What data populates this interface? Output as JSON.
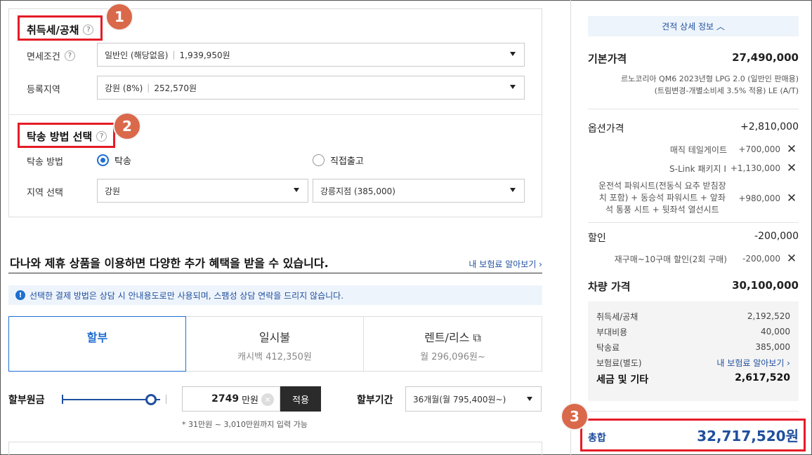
{
  "tax_section": {
    "title": "취득세/공채",
    "duty_free_label": "면세조건",
    "duty_free_value": "일반인 (해당없음)",
    "duty_free_amount": "1,939,950원",
    "region_label": "등록지역",
    "region_value": "강원 (8%)",
    "region_amount": "252,570원"
  },
  "delivery_section": {
    "title": "탁송 방법 선택",
    "method_label": "탁송 방법",
    "option_delivery": "탁송",
    "option_pickup": "직접출고",
    "area_label": "지역 선택",
    "area_value": "강원",
    "branch_value": "강릉지점 (385,000)"
  },
  "badges": [
    "1",
    "2",
    "3"
  ],
  "question_mark": "?",
  "promo": {
    "title": "다나와 제휴 상품을 이용하면 다양한 추가 혜택을 받을 수 있습니다.",
    "link": "내 보험료 알아보기 ›",
    "notice_icon": "!",
    "notice": "선택한 결제 방법은 상담 시 안내용도로만 사용되며, 스팸성 상담 연락을 드리지 않습니다."
  },
  "payment_tabs": [
    {
      "label": "할부",
      "sub": ""
    },
    {
      "label": "일시불",
      "sub": "캐시백 412,350원"
    },
    {
      "label": "렌트/리스 ⧉",
      "sub": "월 296,096원~"
    }
  ],
  "installment": {
    "principal_label": "할부원금",
    "amount": "2749",
    "unit": "만원",
    "clear": "✕",
    "apply": "적용",
    "period_label": "할부기간",
    "period_value": "36개월(월 795,400원~)",
    "hint": "* 31만원 ~ 3,010만원까지 입력 가능",
    "slider_fraction": 0.91
  },
  "summary": {
    "detail_toggle": "견적 상세 정보 ︿",
    "base_label": "기본가격",
    "base_value": "27,490,000",
    "model_line1": "르노코리아 QM6 2023년형 LPG 2.0 (일반인 판매용)",
    "model_line2": "(트림변경-개별소비세 3.5% 적용) LE (A/T)",
    "option_label": "옵션가격",
    "option_value": "+2,810,000",
    "options": [
      {
        "name": "매직 테일게이트",
        "price": "+700,000"
      },
      {
        "name": "S-Link 패키지 I",
        "price": "+1,130,000"
      },
      {
        "name": "운전석 파워시트(전동식 요추 받침장\n치 포함) + 동승석 파워시트 + 앞좌\n석 통풍 시트 + 뒷좌석 열선시트",
        "price": "+980,000"
      }
    ],
    "discount_label": "할인",
    "discount_value": "-200,000",
    "discount_item": "재구매~10구매 할인(2회 구매)",
    "discount_item_price": "-200,000",
    "remove_icon": "✕",
    "car_price_label": "차량 가격",
    "car_price_value": "30,100,000",
    "taxes": [
      {
        "label": "취득세/공채",
        "value": "2,192,520"
      },
      {
        "label": "부대비용",
        "value": "40,000"
      },
      {
        "label": "탁송료",
        "value": "385,000"
      },
      {
        "label": "보험료(별도)",
        "value": "내 보험료 알아보기 ›"
      }
    ],
    "tax_total_label": "세금 및 기타",
    "tax_total_value": "2,617,520",
    "total_label": "총합",
    "total_value": "32,717,520원"
  },
  "colors": {
    "accent": "#1f6fd1",
    "highlight": "#e41c26",
    "badge": "#d9694a"
  }
}
